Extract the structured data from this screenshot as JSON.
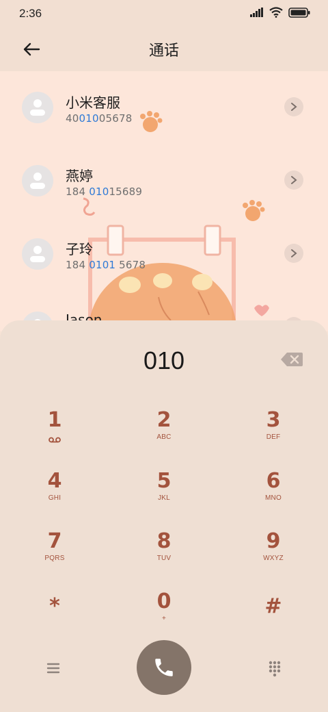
{
  "status": {
    "time": "2:36"
  },
  "appbar": {
    "title": "通话"
  },
  "contacts": [
    {
      "name": "小米客服",
      "number_pre": "40",
      "number_hl": "010",
      "number_post": "05678"
    },
    {
      "name": "燕婷",
      "number_pre": "184 ",
      "number_hl": "010",
      "number_post": "15689"
    },
    {
      "name": "子玲",
      "number_pre": "184 ",
      "number_hl": "0101",
      "number_post": " 5678"
    },
    {
      "name": "Jason",
      "number_pre": "",
      "number_hl": "",
      "number_post": ""
    }
  ],
  "dialpad": {
    "entered": "010",
    "keys": [
      {
        "digit": "1",
        "letters": ""
      },
      {
        "digit": "2",
        "letters": "ABC"
      },
      {
        "digit": "3",
        "letters": "DEF"
      },
      {
        "digit": "4",
        "letters": "GHI"
      },
      {
        "digit": "5",
        "letters": "JKL"
      },
      {
        "digit": "6",
        "letters": "MNO"
      },
      {
        "digit": "7",
        "letters": "PQRS"
      },
      {
        "digit": "8",
        "letters": "TUV"
      },
      {
        "digit": "9",
        "letters": "WXYZ"
      },
      {
        "digit": "*",
        "letters": ""
      },
      {
        "digit": "0",
        "letters": "+"
      },
      {
        "digit": "#",
        "letters": ""
      }
    ]
  },
  "colors": {
    "accent_keys": "#a3533d",
    "call_button": "#847469",
    "highlight": "#2f7ad6"
  },
  "icons": {
    "back": "arrow-left-icon",
    "backspace": "backspace-icon",
    "voicemail": "voicemail-icon",
    "call": "phone-icon",
    "menu": "menu-icon",
    "keypad": "dialpad-icon",
    "chevron": "chevron-right-icon"
  }
}
